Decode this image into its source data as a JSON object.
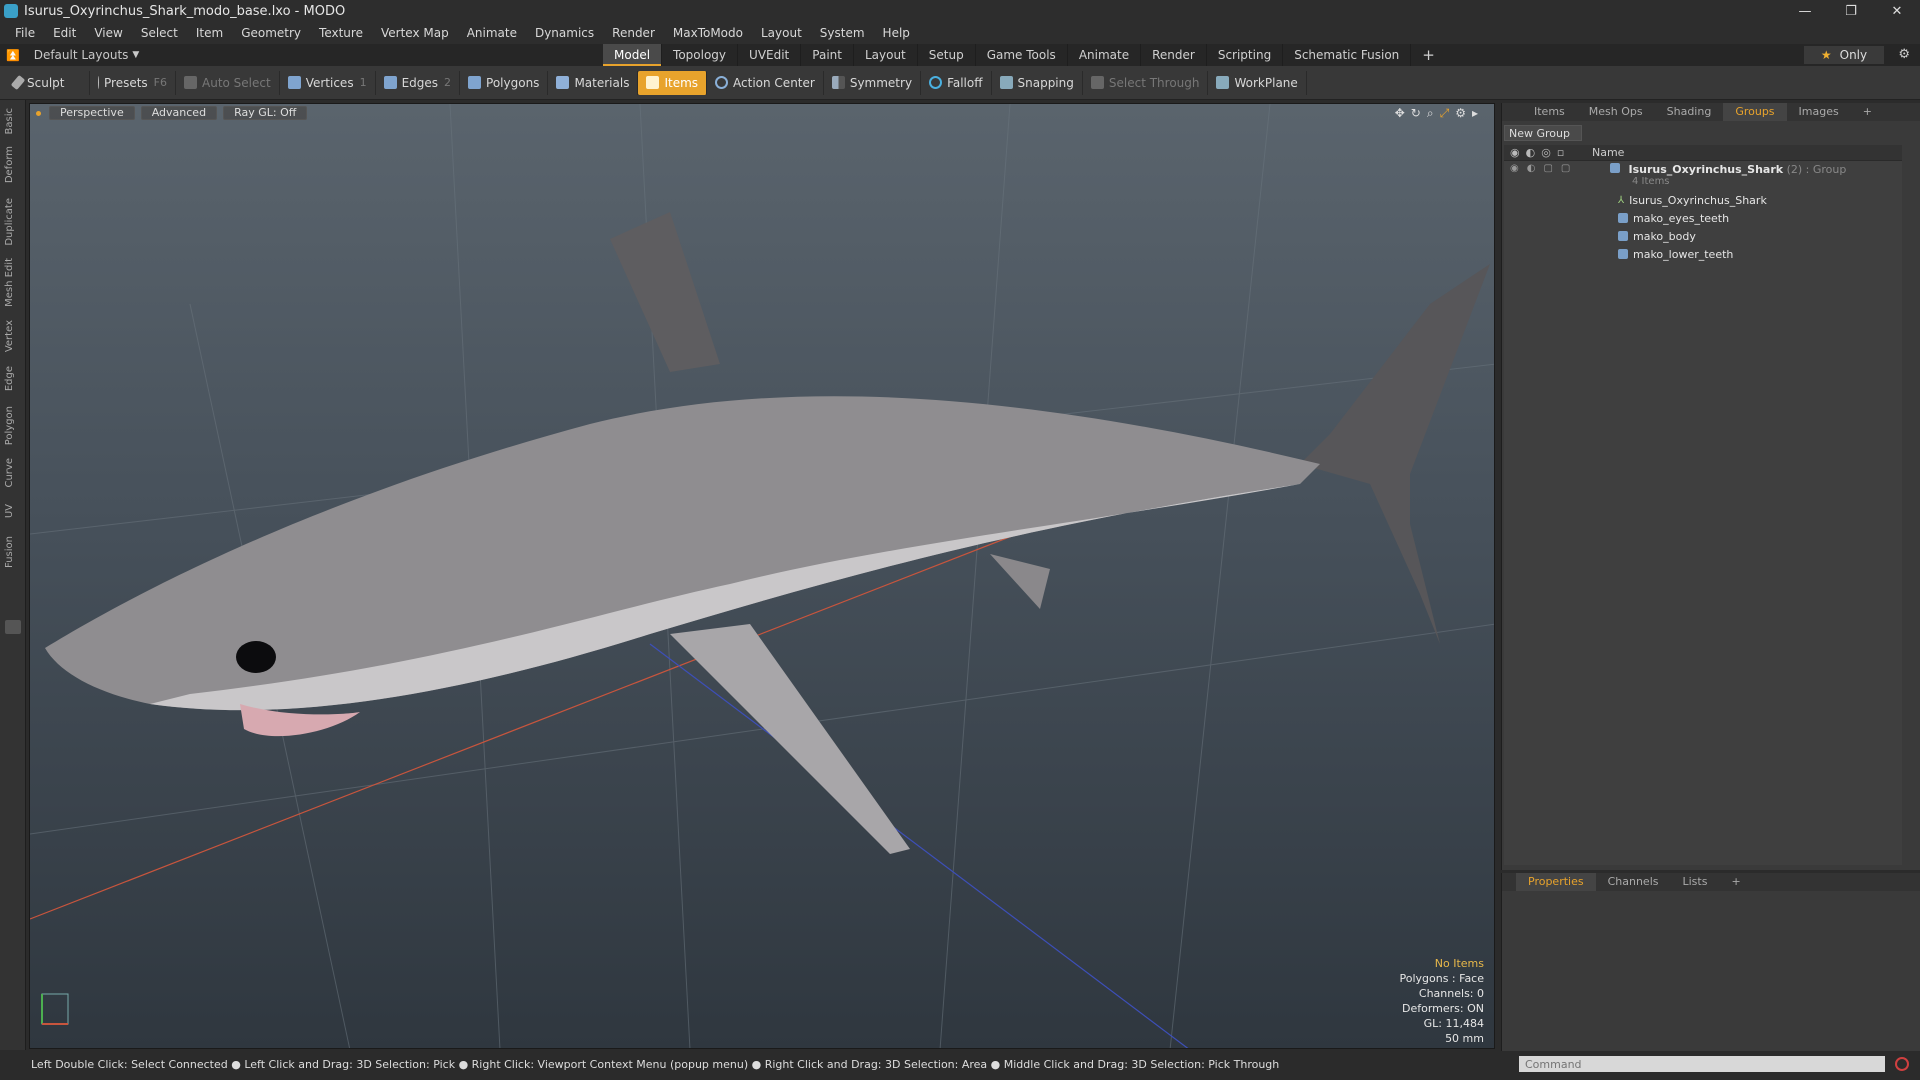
{
  "window": {
    "title": "Isurus_Oxyrinchus_Shark_modo_base.lxo - MODO",
    "controls": [
      "—",
      "❐",
      "✕"
    ]
  },
  "menu": [
    "File",
    "Edit",
    "View",
    "Select",
    "Item",
    "Geometry",
    "Texture",
    "Vertex Map",
    "Animate",
    "Dynamics",
    "Render",
    "MaxToModo",
    "Layout",
    "System",
    "Help"
  ],
  "layout": {
    "current": "Default Layouts",
    "tabs": [
      "Model",
      "Topology",
      "UVEdit",
      "Paint",
      "Layout",
      "Setup",
      "Game Tools",
      "Animate",
      "Render",
      "Scripting",
      "Schematic Fusion"
    ],
    "active_tab": "Model",
    "only_label": "Only"
  },
  "toolbar": {
    "sculpt": "Sculpt",
    "presets": "Presets",
    "presets_key": "F6",
    "auto_select": "Auto Select",
    "vertices": "Vertices",
    "vertices_key": "1",
    "edges": "Edges",
    "edges_key": "2",
    "polygons": "Polygons",
    "materials": "Materials",
    "items": "Items",
    "action_center": "Action Center",
    "symmetry": "Symmetry",
    "falloff": "Falloff",
    "snapping": "Snapping",
    "select_through": "Select Through",
    "workplane": "WorkPlane"
  },
  "left_tabs": [
    "Basic",
    "Deform",
    "Duplicate",
    "Mesh Edit",
    "Vertex",
    "Edge",
    "Polygon",
    "Curve",
    "UV",
    "Fusion"
  ],
  "viewport": {
    "view": "Perspective",
    "mode": "Advanced",
    "raygl": "Ray GL: Off",
    "info": {
      "selection": "No Items",
      "polygons": "Polygons : Face",
      "channels": "Channels: 0",
      "deformers": "Deformers: ON",
      "gl": "GL: 11,484",
      "scale": "50 mm"
    }
  },
  "status": "Left Double Click: Select Connected ● Left Click and Drag: 3D Selection: Pick ● Right Click: Viewport Context Menu (popup menu) ● Right Click and Drag: 3D Selection: Area ● Middle Click and Drag: 3D Selection: Pick Through",
  "right_panel": {
    "tabs": [
      "Items",
      "Mesh Ops",
      "Shading",
      "Groups",
      "Images"
    ],
    "active_tab": "Groups",
    "new_group": "New Group",
    "name_header": "Name",
    "group": {
      "name": "Isurus_Oxyrinchus_Shark",
      "count": "(2)",
      "type": ": Group",
      "sub": "4 Items"
    },
    "children": [
      "Isurus_Oxyrinchus_Shark",
      "mako_eyes_teeth",
      "mako_body",
      "mako_lower_teeth"
    ]
  },
  "properties_panel": {
    "tabs": [
      "Properties",
      "Channels",
      "Lists"
    ],
    "active_tab": "Properties"
  },
  "command": {
    "placeholder": "Command"
  }
}
